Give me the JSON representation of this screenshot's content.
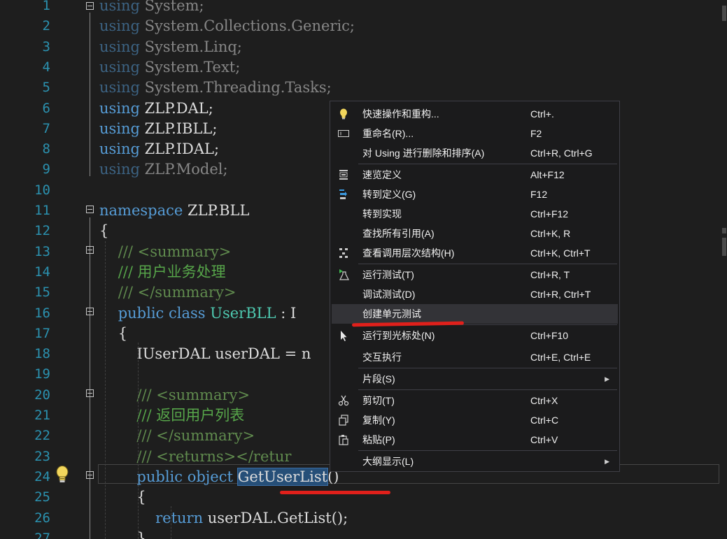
{
  "editor": {
    "lines": [
      {
        "n": "1",
        "tokens": [
          {
            "t": "using",
            "c": "kw dim"
          },
          {
            "t": " System;",
            "c": "dim"
          }
        ]
      },
      {
        "n": "2",
        "tokens": [
          {
            "t": "using",
            "c": "kw dim"
          },
          {
            "t": " System.Collections.Generic;",
            "c": "dim"
          }
        ]
      },
      {
        "n": "3",
        "tokens": [
          {
            "t": "using",
            "c": "kw dim"
          },
          {
            "t": " System.Linq;",
            "c": "dim"
          }
        ]
      },
      {
        "n": "4",
        "tokens": [
          {
            "t": "using",
            "c": "kw dim"
          },
          {
            "t": " System.Text;",
            "c": "dim"
          }
        ]
      },
      {
        "n": "5",
        "tokens": [
          {
            "t": "using",
            "c": "kw dim"
          },
          {
            "t": " System.Threading.Tasks;",
            "c": "dim"
          }
        ]
      },
      {
        "n": "6",
        "tokens": [
          {
            "t": "using",
            "c": "kw"
          },
          {
            "t": " ZLP.DAL;",
            "c": ""
          }
        ]
      },
      {
        "n": "7",
        "tokens": [
          {
            "t": "using",
            "c": "kw"
          },
          {
            "t": " ZLP.IBLL;",
            "c": ""
          }
        ]
      },
      {
        "n": "8",
        "tokens": [
          {
            "t": "using",
            "c": "kw"
          },
          {
            "t": " ZLP.IDAL;",
            "c": ""
          }
        ]
      },
      {
        "n": "9",
        "tokens": [
          {
            "t": "using",
            "c": "kw dim"
          },
          {
            "t": " ZLP.Model;",
            "c": "dim"
          }
        ]
      },
      {
        "n": "10",
        "tokens": []
      },
      {
        "n": "11",
        "tokens": [
          {
            "t": "namespace",
            "c": "kw"
          },
          {
            "t": " ZLP.BLL",
            "c": ""
          }
        ]
      },
      {
        "n": "12",
        "tokens": [
          {
            "t": "{",
            "c": ""
          }
        ]
      },
      {
        "n": "13",
        "tokens": [
          {
            "t": "    /// <summary>",
            "c": "cmx"
          }
        ]
      },
      {
        "n": "14",
        "tokens": [
          {
            "t": "    /// 用户业务处理",
            "c": "cm"
          }
        ]
      },
      {
        "n": "15",
        "tokens": [
          {
            "t": "    /// </summary>",
            "c": "cmx"
          }
        ]
      },
      {
        "n": "16",
        "tokens": [
          {
            "t": "    ",
            "c": ""
          },
          {
            "t": "public",
            "c": "kw"
          },
          {
            "t": " ",
            "c": ""
          },
          {
            "t": "class",
            "c": "kw"
          },
          {
            "t": " ",
            "c": ""
          },
          {
            "t": "UserBLL",
            "c": "ty"
          },
          {
            "t": " : I",
            "c": ""
          }
        ]
      },
      {
        "n": "17",
        "tokens": [
          {
            "t": "    {",
            "c": ""
          }
        ]
      },
      {
        "n": "18",
        "tokens": [
          {
            "t": "        IUserDAL userDAL = n",
            "c": ""
          }
        ]
      },
      {
        "n": "19",
        "tokens": []
      },
      {
        "n": "20",
        "tokens": [
          {
            "t": "        /// <summary>",
            "c": "cmx"
          }
        ]
      },
      {
        "n": "21",
        "tokens": [
          {
            "t": "        /// 返回用户列表",
            "c": "cm"
          }
        ]
      },
      {
        "n": "22",
        "tokens": [
          {
            "t": "        /// </summary>",
            "c": "cmx"
          }
        ]
      },
      {
        "n": "23",
        "tokens": [
          {
            "t": "        /// <returns></retur",
            "c": "cmx"
          }
        ]
      },
      {
        "n": "24",
        "tokens": [
          {
            "t": "        ",
            "c": ""
          },
          {
            "t": "public",
            "c": "kw"
          },
          {
            "t": " ",
            "c": ""
          },
          {
            "t": "object",
            "c": "kw"
          },
          {
            "t": " ",
            "c": ""
          },
          {
            "t": "GetUserList",
            "c": "sel"
          },
          {
            "t": "()",
            "c": ""
          }
        ]
      },
      {
        "n": "25",
        "tokens": [
          {
            "t": "        {",
            "c": ""
          }
        ]
      },
      {
        "n": "26",
        "tokens": [
          {
            "t": "            ",
            "c": ""
          },
          {
            "t": "return",
            "c": "kw"
          },
          {
            "t": " userDAL.GetList();",
            "c": ""
          }
        ]
      },
      {
        "n": "27",
        "tokens": [
          {
            "t": "        }",
            "c": ""
          }
        ]
      }
    ]
  },
  "context_menu": {
    "items": [
      {
        "label": "快速操作和重构...",
        "shortcut": "Ctrl+.",
        "icon": "lightbulb-icon"
      },
      {
        "label": "重命名(R)...",
        "shortcut": "F2",
        "icon": "rename-icon"
      },
      {
        "label": "对 Using 进行删除和排序(A)",
        "shortcut": "Ctrl+R, Ctrl+G",
        "icon": ""
      },
      {
        "label": "速览定义",
        "shortcut": "Alt+F12",
        "icon": "peek-definition-icon"
      },
      {
        "label": "转到定义(G)",
        "shortcut": "F12",
        "icon": "go-to-definition-icon"
      },
      {
        "label": "转到实现",
        "shortcut": "Ctrl+F12",
        "icon": ""
      },
      {
        "label": "查找所有引用(A)",
        "shortcut": "Ctrl+K, R",
        "icon": ""
      },
      {
        "label": "查看调用层次结构(H)",
        "shortcut": "Ctrl+K, Ctrl+T",
        "icon": "call-hierarchy-icon"
      },
      {
        "label": "运行测试(T)",
        "shortcut": "Ctrl+R, T",
        "icon": "run-tests-icon"
      },
      {
        "label": "调试测试(D)",
        "shortcut": "Ctrl+R, Ctrl+T",
        "icon": ""
      },
      {
        "label": "创建单元测试",
        "shortcut": "",
        "icon": ""
      },
      {
        "label": "运行到光标处(N)",
        "shortcut": "Ctrl+F10",
        "icon": "cursor-icon"
      },
      {
        "label": "交互执行",
        "shortcut": "Ctrl+E, Ctrl+E",
        "icon": ""
      },
      {
        "label": "片段(S)",
        "shortcut": "",
        "icon": ""
      },
      {
        "label": "剪切(T)",
        "shortcut": "Ctrl+X",
        "icon": "cut-icon"
      },
      {
        "label": "复制(Y)",
        "shortcut": "Ctrl+C",
        "icon": "copy-icon"
      },
      {
        "label": "粘贴(P)",
        "shortcut": "Ctrl+V",
        "icon": "paste-icon"
      },
      {
        "label": "大纲显示(L)",
        "shortcut": "",
        "icon": ""
      }
    ],
    "highlighted": "创建单元测试"
  },
  "colors": {
    "keyword": "#569cd6",
    "type": "#4ec9b0",
    "comment": "#57a64a",
    "line_number": "#2b91af",
    "background": "#1e1e1e",
    "annotation_red": "#e0201b"
  }
}
